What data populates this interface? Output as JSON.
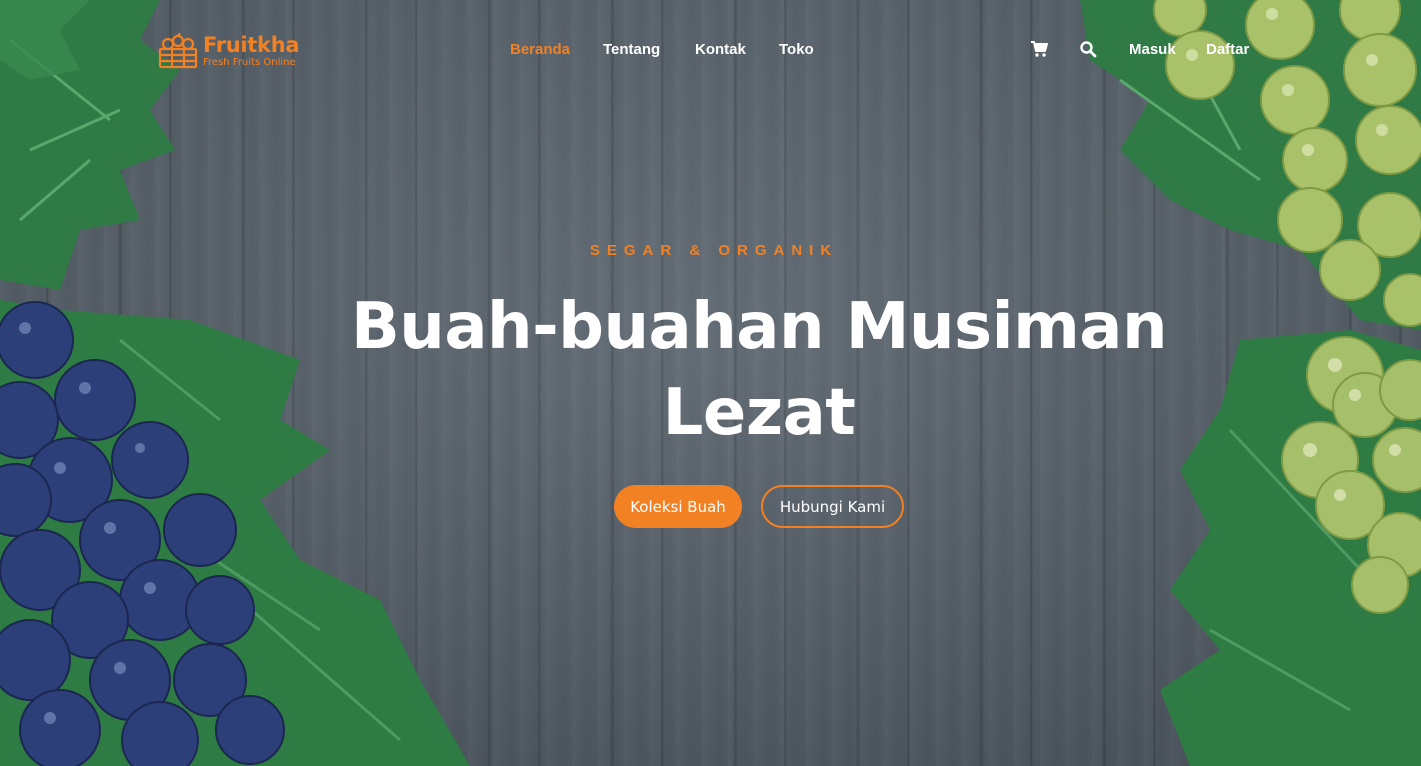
{
  "brand": {
    "name": "Fruitkha",
    "tagline": "Fresh Fruits Online",
    "accent_color": "#f28123",
    "logo_icon": "fruit-basket-icon"
  },
  "nav": {
    "items": [
      {
        "label": "Beranda",
        "active": true
      },
      {
        "label": "Tentang",
        "active": false
      },
      {
        "label": "Kontak",
        "active": false
      },
      {
        "label": "Toko",
        "active": false
      }
    ]
  },
  "header_actions": {
    "cart_icon": "shopping-cart-icon",
    "search_icon": "search-icon",
    "login_label": "Masuk",
    "register_label": "Daftar"
  },
  "hero": {
    "subtitle": "SEGAR & ORGANIK",
    "title": "Buah-buahan Musiman Lezat",
    "primary_button": "Koleksi Buah",
    "secondary_button": "Hubungi Kami",
    "background": "wood-table-with-grapes-image"
  }
}
